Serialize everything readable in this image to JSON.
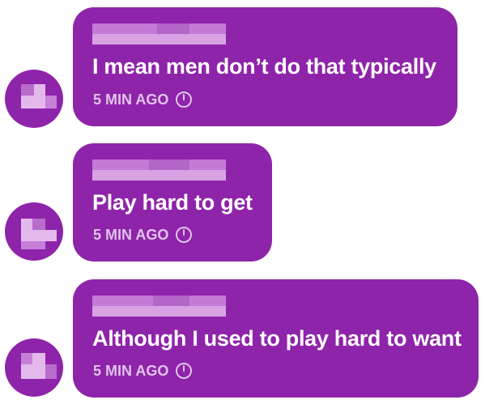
{
  "colors": {
    "bubble": "#8e24aa",
    "text": "#ffffff",
    "meta_text": "#e0c3ea"
  },
  "messages": [
    {
      "text": "I mean men don’t do that typically",
      "time": "5 MIN AGO",
      "time_icon": "clock-icon"
    },
    {
      "text": "Play hard to get",
      "time": "5 MIN AGO",
      "time_icon": "clock-icon"
    },
    {
      "text": "Although I used to play hard to want",
      "time": "5 MIN AGO",
      "time_icon": "clock-icon"
    }
  ]
}
